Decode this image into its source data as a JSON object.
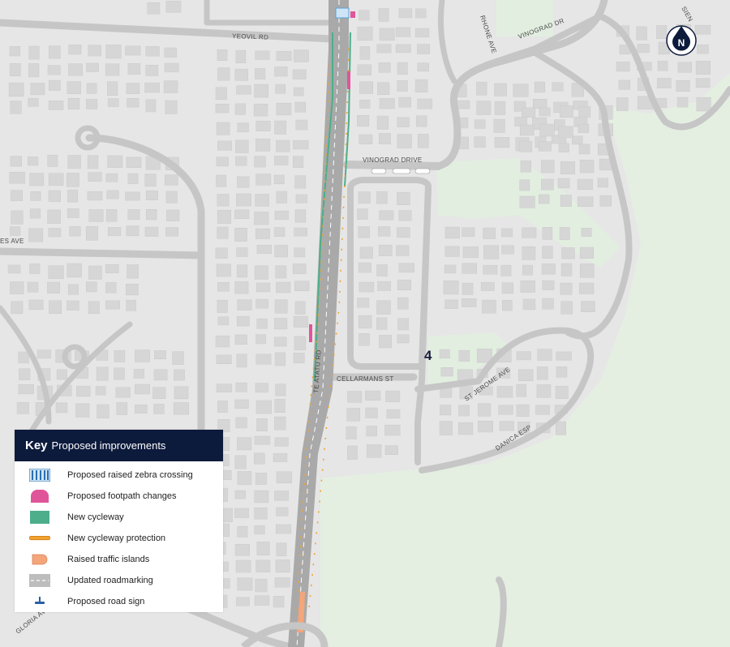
{
  "legend": {
    "key_label": "Key",
    "title": "Proposed improvements",
    "items": [
      {
        "label": "Proposed raised zebra crossing",
        "icon": "zebra-crossing-icon",
        "color": "#5aa0d6"
      },
      {
        "label": "Proposed footpath changes",
        "icon": "footpath-change-icon",
        "color": "#e0559a"
      },
      {
        "label": "New cycleway",
        "icon": "cycleway-icon",
        "color": "#4cae8a"
      },
      {
        "label": "New cycleway protection",
        "icon": "cycleway-protection-icon",
        "color": "#f2a32e"
      },
      {
        "label": "Raised traffic islands",
        "icon": "traffic-island-icon",
        "color": "#f4a57a"
      },
      {
        "label": "Updated roadmarking",
        "icon": "roadmarking-icon",
        "color": "#bdbdbd"
      },
      {
        "label": "Proposed road sign",
        "icon": "road-sign-icon",
        "color": "#2a5ea8"
      }
    ]
  },
  "compass": {
    "label": "N"
  },
  "area_number": "4",
  "streets": {
    "yeovil": "YEOVIL RD",
    "vinograd_drive": "VINOGRAD DRIVE",
    "vinograd_dr": "VINOGRAD DR",
    "rhone": "RHONE AVE",
    "te_atatu": "TE ATATU RD",
    "cellarmans": "CELLARMANS ST",
    "st_jerome": "ST JEROME AVE",
    "danica": "DANICA ESP",
    "gloria": "GLORIA AVE",
    "es_ave": "ES AVE",
    "sien": "SIEN"
  },
  "colors": {
    "background": "#e6e6e6",
    "road": "#c4c4c4",
    "park": "#e4efe2",
    "legend_header": "#0c1a3c"
  }
}
